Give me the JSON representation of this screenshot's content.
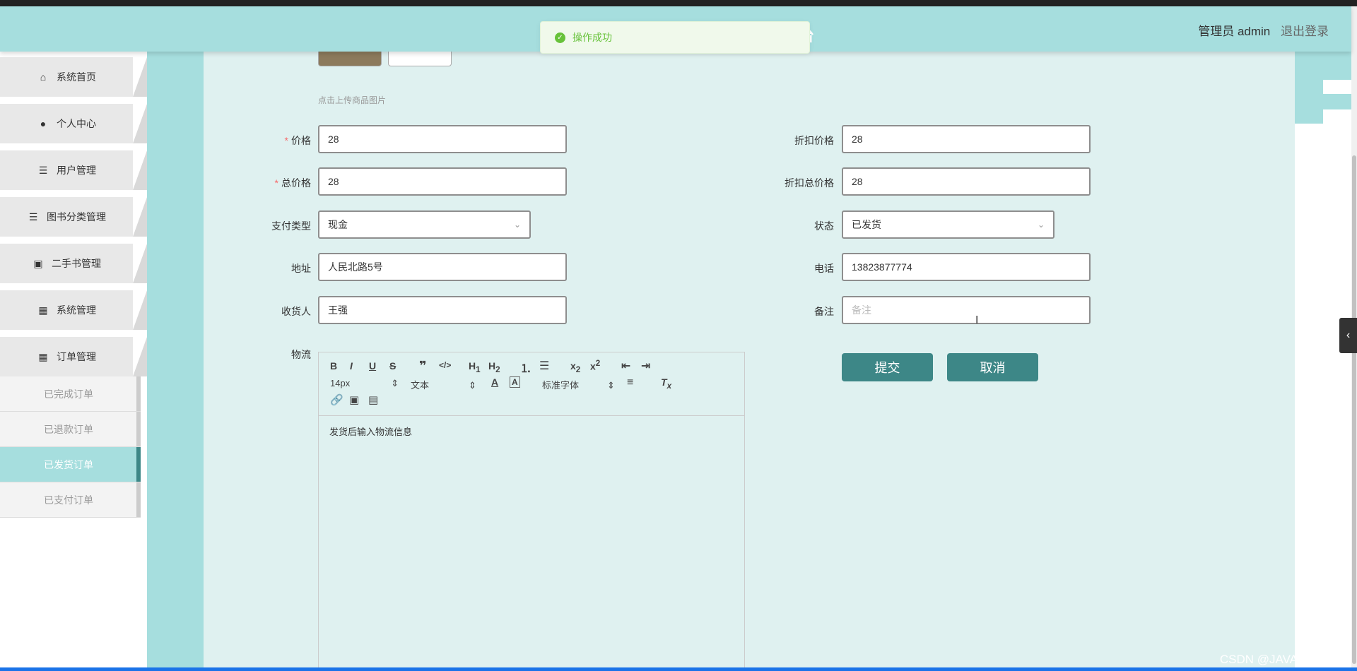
{
  "header": {
    "user_label": "管理员 admin",
    "logout_label": "退出登录",
    "title_tail": "台"
  },
  "toast": {
    "message": "操作成功"
  },
  "sidebar": {
    "items": [
      {
        "label": "系统首页",
        "icon": "home-icon",
        "glyph": "⌂"
      },
      {
        "label": "个人中心",
        "icon": "user-icon",
        "glyph": "●"
      },
      {
        "label": "用户管理",
        "icon": "list-icon",
        "glyph": "☰"
      },
      {
        "label": "图书分类管理",
        "icon": "list-icon",
        "glyph": "☰"
      },
      {
        "label": "二手书管理",
        "icon": "clipboard-icon",
        "glyph": "▣"
      },
      {
        "label": "系统管理",
        "icon": "grid-icon",
        "glyph": "▦"
      },
      {
        "label": "订单管理",
        "icon": "grid-icon",
        "glyph": "▦"
      }
    ],
    "subitems": [
      {
        "label": "已完成订单",
        "active": false
      },
      {
        "label": "已退款订单",
        "active": false
      },
      {
        "label": "已发货订单",
        "active": true
      },
      {
        "label": "已支付订单",
        "active": false
      }
    ]
  },
  "form": {
    "upload_tip": "点击上传商品图片",
    "price": {
      "label": "价格",
      "value": "28",
      "required": true
    },
    "discount_price": {
      "label": "折扣价格",
      "value": "28"
    },
    "total_price": {
      "label": "总价格",
      "value": "28",
      "required": true
    },
    "discount_total_price": {
      "label": "折扣总价格",
      "value": "28"
    },
    "payment_type": {
      "label": "支付类型",
      "value": "现金"
    },
    "status": {
      "label": "状态",
      "value": "已发货"
    },
    "address": {
      "label": "地址",
      "value": "人民北路5号"
    },
    "phone": {
      "label": "电话",
      "value": "13823877774"
    },
    "receiver": {
      "label": "收货人",
      "value": "王强"
    },
    "remark": {
      "label": "备注",
      "value": "",
      "placeholder": "备注"
    },
    "logistics": {
      "label": "物流",
      "content": "发货后输入物流信息"
    }
  },
  "editor_toolbar": {
    "font_size": "14px",
    "text_style": "文本",
    "font_family": "标准字体"
  },
  "buttons": {
    "submit": "提交",
    "cancel": "取消"
  },
  "watermark": "CSDN @JAVA程序设计"
}
